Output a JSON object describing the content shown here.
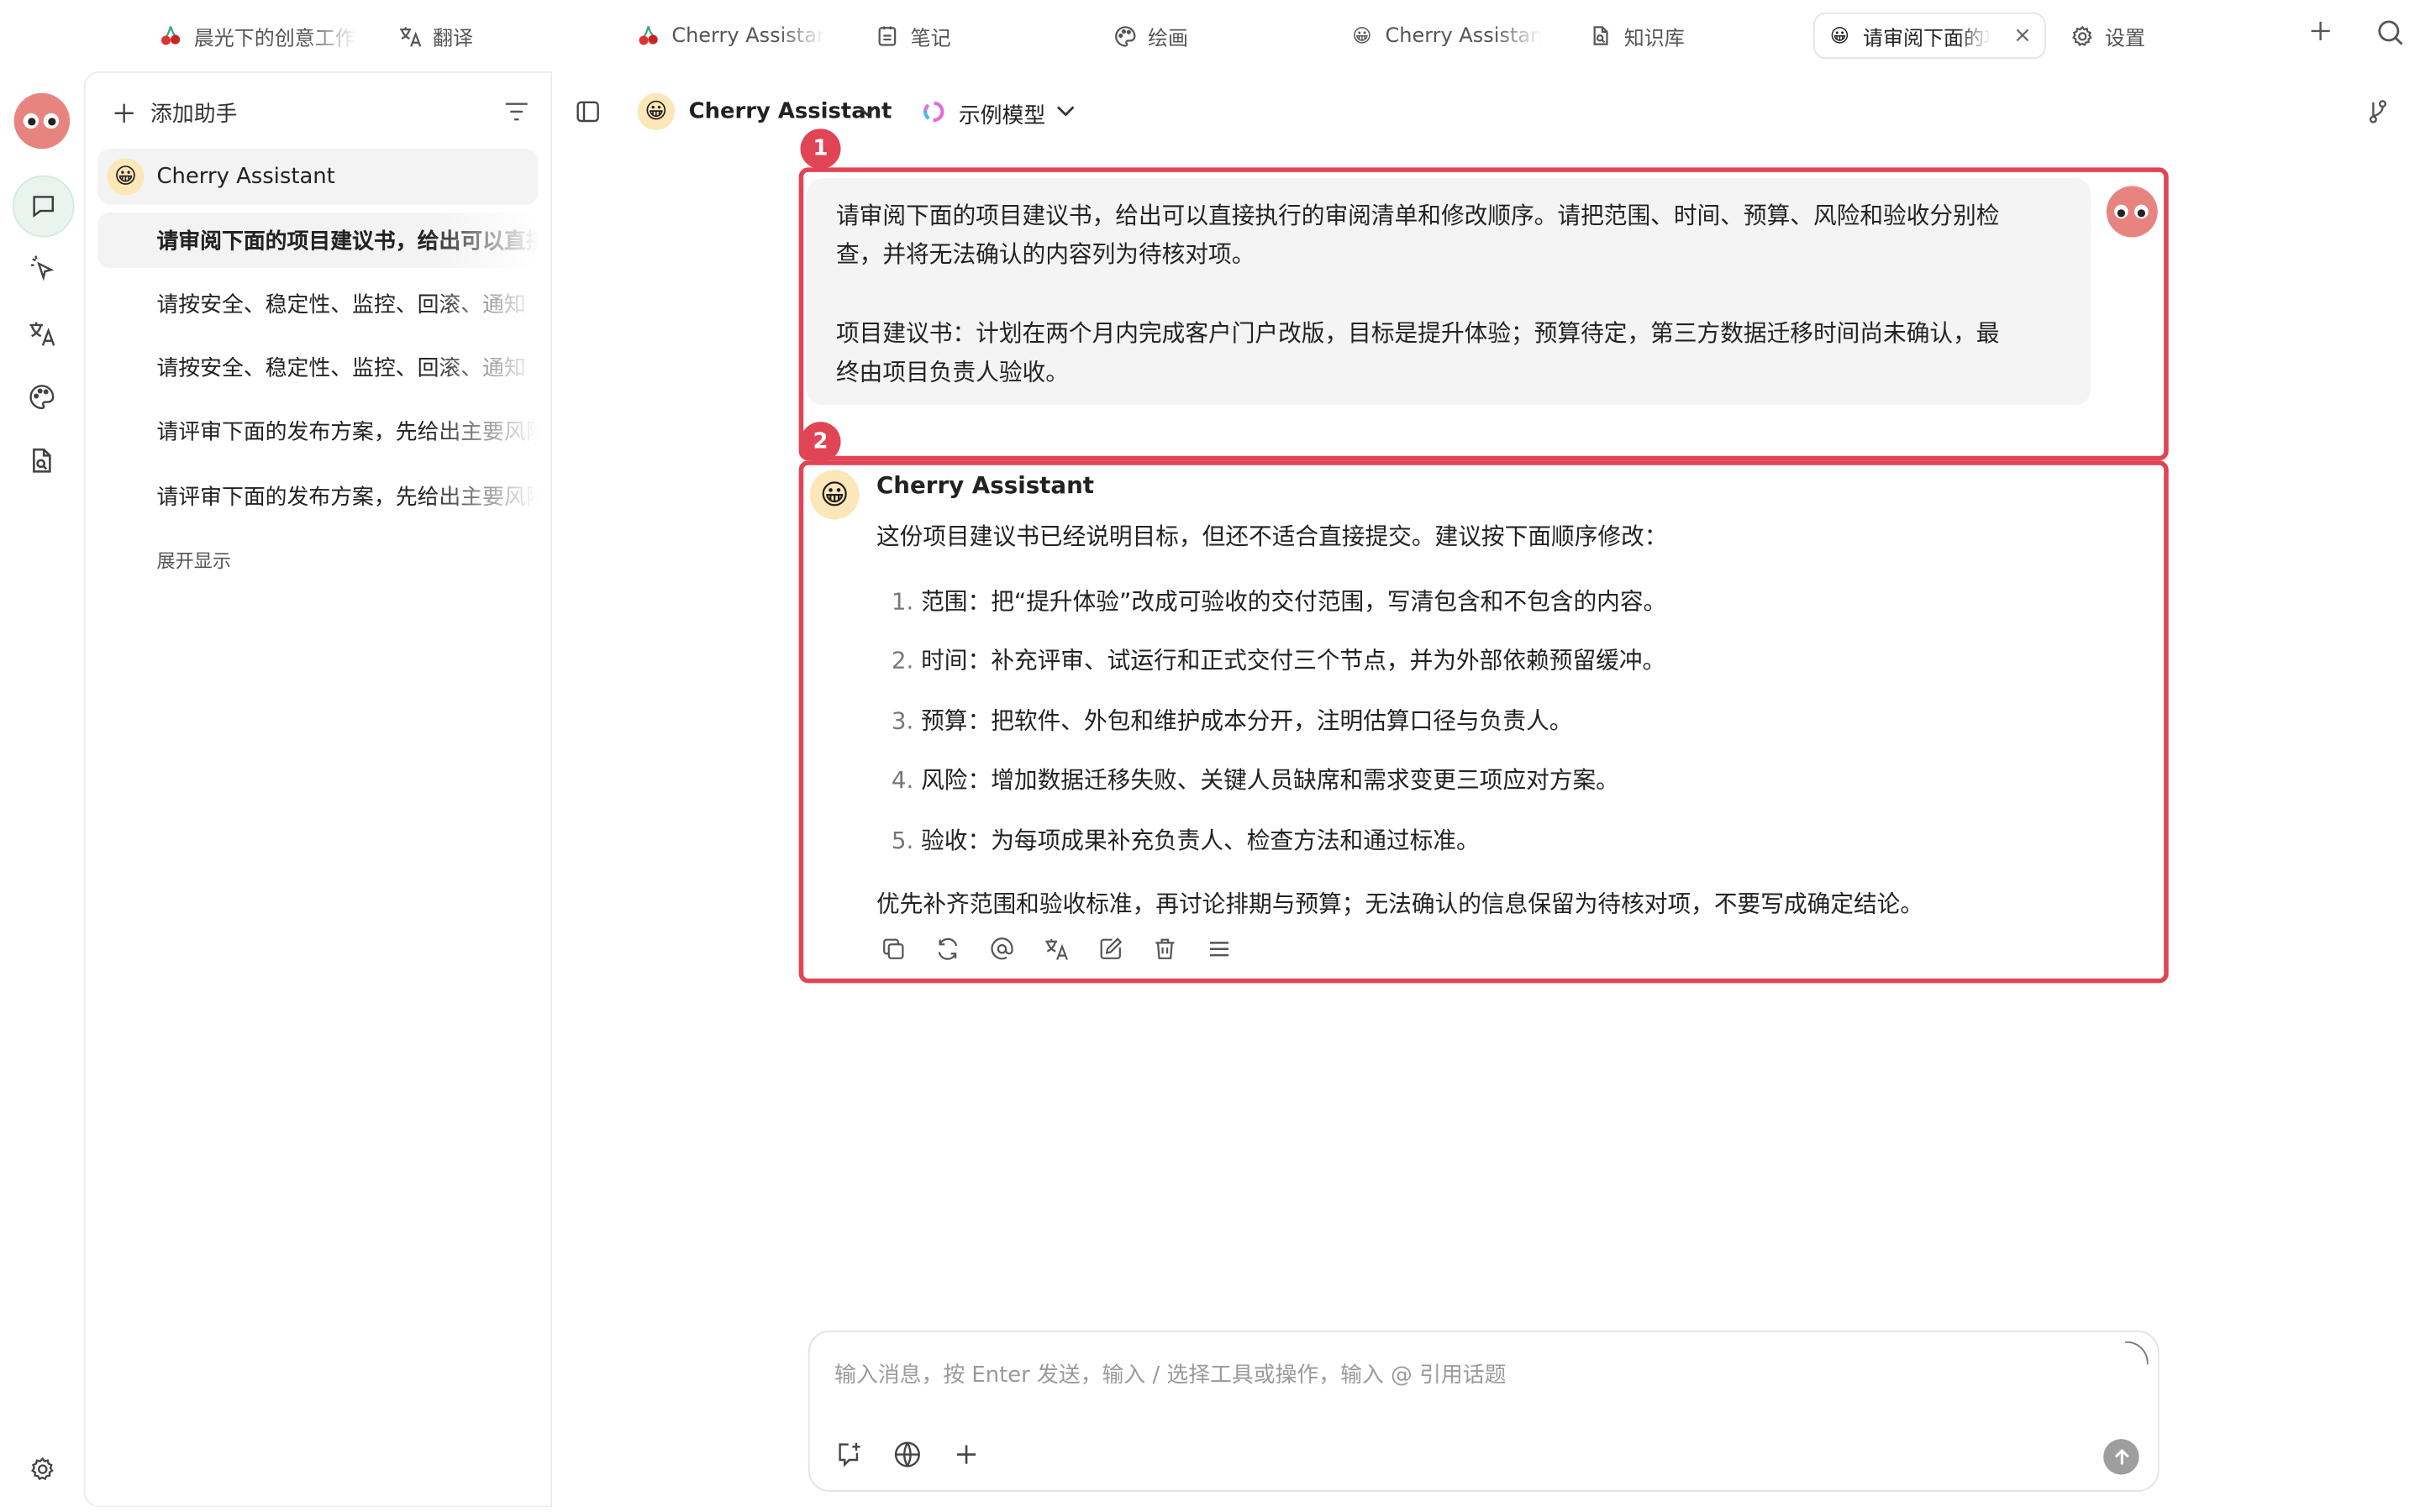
{
  "tabs": [
    {
      "icon": "cherry-icon",
      "label": "晨光下的创意工作"
    },
    {
      "icon": "translate-icon",
      "label": "翻译"
    },
    {
      "icon": "cherry-icon",
      "label": "Cherry Assistant"
    },
    {
      "icon": "notes-icon",
      "label": "笔记"
    },
    {
      "icon": "palette-icon",
      "label": "绘画"
    },
    {
      "icon": "smiley-icon",
      "label": "Cherry Assistant"
    },
    {
      "icon": "knowledge-icon",
      "label": "知识库"
    },
    {
      "icon": "smiley-icon",
      "label": "请审阅下面的项目建议书",
      "close": "×"
    },
    {
      "icon": "gear-icon",
      "label": "设置"
    }
  ],
  "sidebar": {
    "add_label": "添加助手",
    "assistant": {
      "emoji": "😀",
      "name": "Cherry Assistant"
    },
    "topics": [
      "请审阅下面的项目建议书，给出可以直接执行的审阅清单",
      "请按安全、稳定性、监控、回滚、通知",
      "请按安全、稳定性、监控、回滚、通知",
      "请评审下面的发布方案，先给出主要风险",
      "请评审下面的发布方案，先给出主要风险"
    ],
    "expand_label": "展开显示"
  },
  "header": {
    "assistant_emoji": "😀",
    "assistant_name": "Cherry Assistant",
    "model_name": "示例模型"
  },
  "badges": [
    "1",
    "2"
  ],
  "user_message": {
    "line1": "请审阅下面的项目建议书，给出可以直接执行的审阅清单和修改顺序。请把范围、时间、预算、风险和验收分别检",
    "line2": "查，并将无法确认的内容列为待核对项。",
    "line3": "项目建议书：计划在两个月内完成客户门户改版，目标是提升体验；预算待定，第三方数据迁移时间尚未确认，最",
    "line4": "终由项目负责人验收。"
  },
  "assistant_message": {
    "name": "Cherry Assistant",
    "emoji": "😀",
    "intro": "这份项目建议书已经说明目标，但还不适合直接提交。建议按下面顺序修改：",
    "items": [
      {
        "num": "1.",
        "text": "范围：把“提升体验”改成可验收的交付范围，写清包含和不包含的内容。"
      },
      {
        "num": "2.",
        "text": "时间：补充评审、试运行和正式交付三个节点，并为外部依赖预留缓冲。"
      },
      {
        "num": "3.",
        "text": "预算：把软件、外包和维护成本分开，注明估算口径与负责人。"
      },
      {
        "num": "4.",
        "text": "风险：增加数据迁移失败、关键人员缺席和需求变更三项应对方案。"
      },
      {
        "num": "5.",
        "text": "验收：为每项成果补充负责人、检查方法和通过标准。"
      }
    ],
    "conclusion": "优先补齐范围和验收标准，再讨论排期与预算；无法确认的信息保留为待核对项，不要写成确定结论。"
  },
  "input": {
    "placeholder": "输入消息，按 Enter 发送，输入 / 选择工具或操作，输入 @ 引用话题"
  },
  "colors": {
    "accent": "#e04455",
    "rail_active": "#e9f4ef",
    "avatar": "#e8847f"
  }
}
